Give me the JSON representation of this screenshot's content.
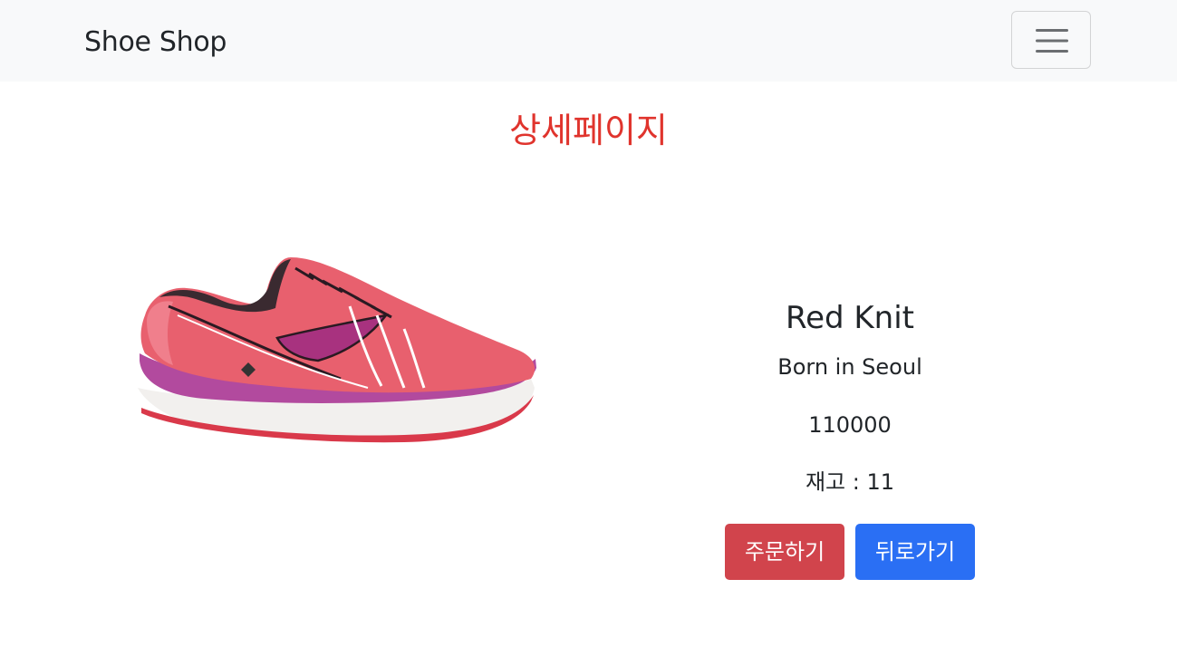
{
  "navbar": {
    "brand": "Shoe Shop",
    "toggler_icon": "hamburger-icon"
  },
  "page": {
    "title": "상세페이지",
    "title_color": "#e0342d"
  },
  "product": {
    "image_icon": "shoe-image",
    "name": "Red Knit",
    "description": "Born in Seoul",
    "price": "110000",
    "stock_label": "재고 : ",
    "stock_value": "11"
  },
  "actions": {
    "order_label": "주문하기",
    "back_label": "뒤로가기"
  },
  "colors": {
    "danger": "#d1444c",
    "primary": "#2a6ff4",
    "navbar_bg": "#f8f9fa"
  }
}
